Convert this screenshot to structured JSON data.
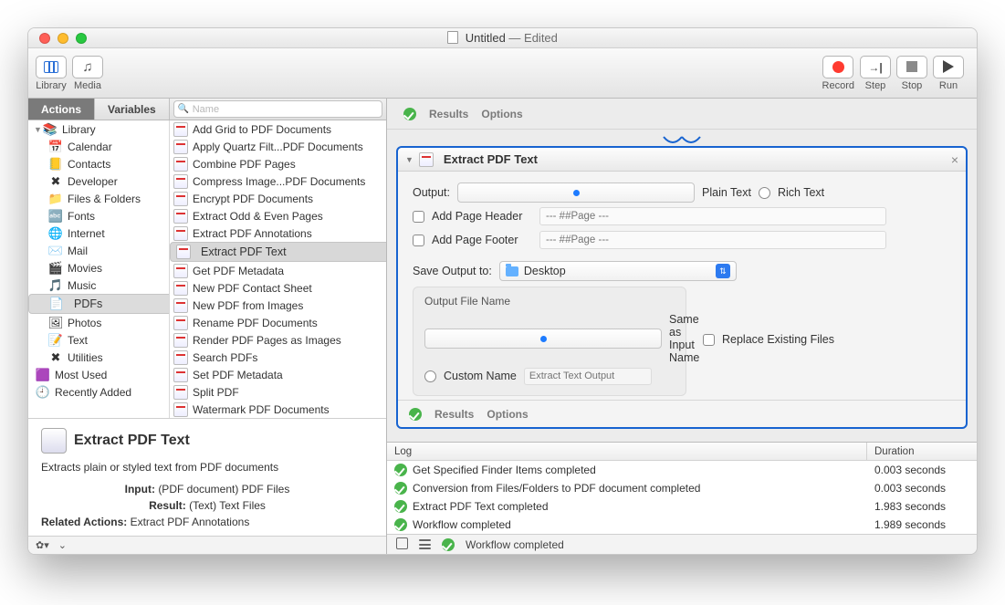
{
  "window": {
    "title_doc": "Untitled",
    "title_status": "— Edited"
  },
  "toolbar": {
    "library": "Library",
    "media": "Media",
    "record": "Record",
    "step": "Step",
    "stop": "Stop",
    "run": "Run"
  },
  "left_tabs": {
    "actions": "Actions",
    "variables": "Variables",
    "search_placeholder": "Name"
  },
  "categories": [
    {
      "label": "Library",
      "disc": true,
      "icon": "📚"
    },
    {
      "label": "Calendar",
      "sub": true,
      "icon": "📅"
    },
    {
      "label": "Contacts",
      "sub": true,
      "icon": "📒"
    },
    {
      "label": "Developer",
      "sub": true,
      "icon": "✖︎"
    },
    {
      "label": "Files & Folders",
      "sub": true,
      "icon": "📁"
    },
    {
      "label": "Fonts",
      "sub": true,
      "icon": "🔤"
    },
    {
      "label": "Internet",
      "sub": true,
      "icon": "🌐"
    },
    {
      "label": "Mail",
      "sub": true,
      "icon": "✉️"
    },
    {
      "label": "Movies",
      "sub": true,
      "icon": "🎬"
    },
    {
      "label": "Music",
      "sub": true,
      "icon": "🎵"
    },
    {
      "label": "PDFs",
      "sub": true,
      "icon": "📄",
      "selected": true
    },
    {
      "label": "Photos",
      "sub": true,
      "icon": "🖼"
    },
    {
      "label": "Text",
      "sub": true,
      "icon": "📝"
    },
    {
      "label": "Utilities",
      "sub": true,
      "icon": "✖︎"
    },
    {
      "label": "Most Used",
      "sub2": true,
      "icon": "🟪"
    },
    {
      "label": "Recently Added",
      "sub2": true,
      "icon": "🕘"
    }
  ],
  "actions_list": [
    "Add Grid to PDF Documents",
    "Apply Quartz Filt...PDF Documents",
    "Combine PDF Pages",
    "Compress Image...PDF Documents",
    "Encrypt PDF Documents",
    "Extract Odd & Even Pages",
    "Extract PDF Annotations",
    "Extract PDF Text",
    "Get PDF Metadata",
    "New PDF Contact Sheet",
    "New PDF from Images",
    "Rename PDF Documents",
    "Render PDF Pages as Images",
    "Search PDFs",
    "Set PDF Metadata",
    "Split PDF",
    "Watermark PDF Documents"
  ],
  "selected_action_index": 7,
  "info": {
    "title": "Extract PDF Text",
    "desc": "Extracts plain or styled text from PDF documents",
    "input_label": "Input:",
    "input_val": "(PDF document) PDF Files",
    "result_label": "Result:",
    "result_val": "(Text) Text Files",
    "related_label": "Related Actions:",
    "related_val": "Extract PDF Annotations"
  },
  "prev": {
    "results": "Results",
    "options": "Options"
  },
  "action": {
    "title": "Extract PDF Text",
    "output_label": "Output:",
    "plain": "Plain Text",
    "rich": "Rich Text",
    "header_chk": "Add Page Header",
    "footer_chk": "Add Page Footer",
    "page_placeholder": "--- ##Page ---",
    "save_label": "Save Output to:",
    "save_loc": "Desktop",
    "ofn_label": "Output File Name",
    "same": "Same as Input Name",
    "custom": "Custom Name",
    "custom_placeholder": "Extract Text Output",
    "replace": "Replace Existing Files",
    "results": "Results",
    "options": "Options"
  },
  "log": {
    "col_log": "Log",
    "col_dur": "Duration",
    "rows": [
      {
        "msg": "Get Specified Finder Items completed",
        "dur": "0.003 seconds"
      },
      {
        "msg": "Conversion from Files/Folders to PDF document completed",
        "dur": "0.003 seconds"
      },
      {
        "msg": "Extract PDF Text completed",
        "dur": "1.983 seconds"
      },
      {
        "msg": "Workflow completed",
        "dur": "1.989 seconds"
      }
    ]
  },
  "footer_status": "Workflow completed"
}
